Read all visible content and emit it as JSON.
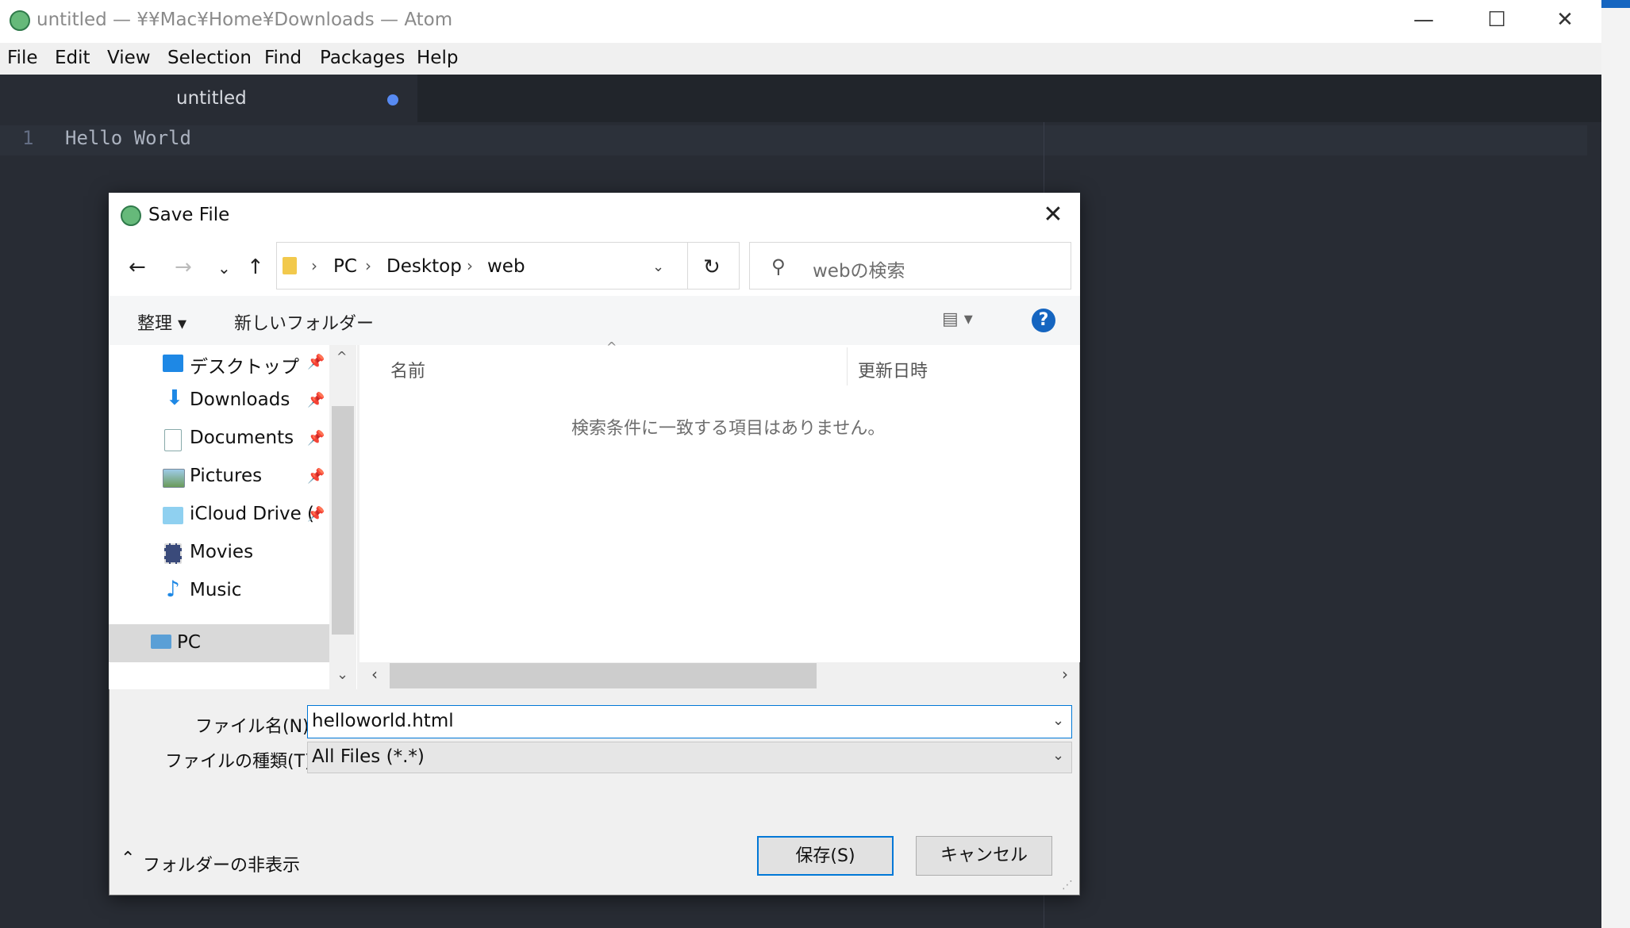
{
  "atom": {
    "title": "untitled — ¥¥Mac¥Home¥Downloads — Atom",
    "menu": [
      "File",
      "Edit",
      "View",
      "Selection",
      "Find",
      "Packages",
      "Help"
    ],
    "tab_label": "untitled",
    "line_number": "1",
    "code_line": "Hello World",
    "window_controls": {
      "minimize": "—",
      "maximize": "☐",
      "close": "✕"
    }
  },
  "dialog": {
    "title": "Save File",
    "nav": {
      "back": "←",
      "forward": "→",
      "recent": "⌄",
      "up": "↑",
      "refresh": "↻"
    },
    "breadcrumb": [
      "PC",
      "Desktop",
      "web"
    ],
    "search_placeholder": "webの検索",
    "toolbar": {
      "organize": "整理 ▾",
      "new_folder": "新しいフォルダー",
      "view": "▤ ▾",
      "help": "?"
    },
    "nav_items": [
      {
        "label": "デスクトップ",
        "icon": "desktop-icon",
        "pinned": true
      },
      {
        "label": "Downloads",
        "icon": "download-icon",
        "pinned": true
      },
      {
        "label": "Documents",
        "icon": "documents-icon",
        "pinned": true
      },
      {
        "label": "Pictures",
        "icon": "pictures-icon",
        "pinned": true
      },
      {
        "label": "iCloud Drive (",
        "icon": "cloud-folder-icon",
        "pinned": true
      },
      {
        "label": "Movies",
        "icon": "movies-icon",
        "pinned": false
      },
      {
        "label": "Music",
        "icon": "music-icon",
        "pinned": false
      }
    ],
    "pc_label": "PC",
    "columns": [
      "名前",
      "更新日時"
    ],
    "empty_message": "検索条件に一致する項目はありません。",
    "filename_label": "ファイル名(N):",
    "filename_value": "helloworld.html",
    "filetype_label": "ファイルの種類(T):",
    "filetype_value": "All Files (*.*)",
    "save_button": "保存(S)",
    "cancel_button": "キャンセル",
    "hide_folders": "フォルダーの非表示"
  }
}
